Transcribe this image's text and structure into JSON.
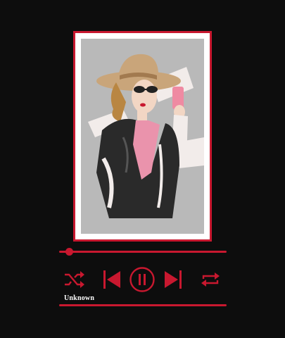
{
  "track": {
    "title": "Unknown",
    "progress_fraction": 0.06
  },
  "artwork": {
    "description_icon": "fashion-illustration-artwork"
  },
  "controls": {
    "shuffle_icon": "shuffle-icon",
    "previous_icon": "skip-back-icon",
    "play_pause_icon": "pause-icon",
    "next_icon": "skip-forward-icon",
    "repeat_icon": "repeat-icon"
  },
  "colors": {
    "background": "#0d0d0d",
    "accent": "#c8182f",
    "frame_mat": "#ffffff",
    "art_background": "#b9b9b9"
  }
}
